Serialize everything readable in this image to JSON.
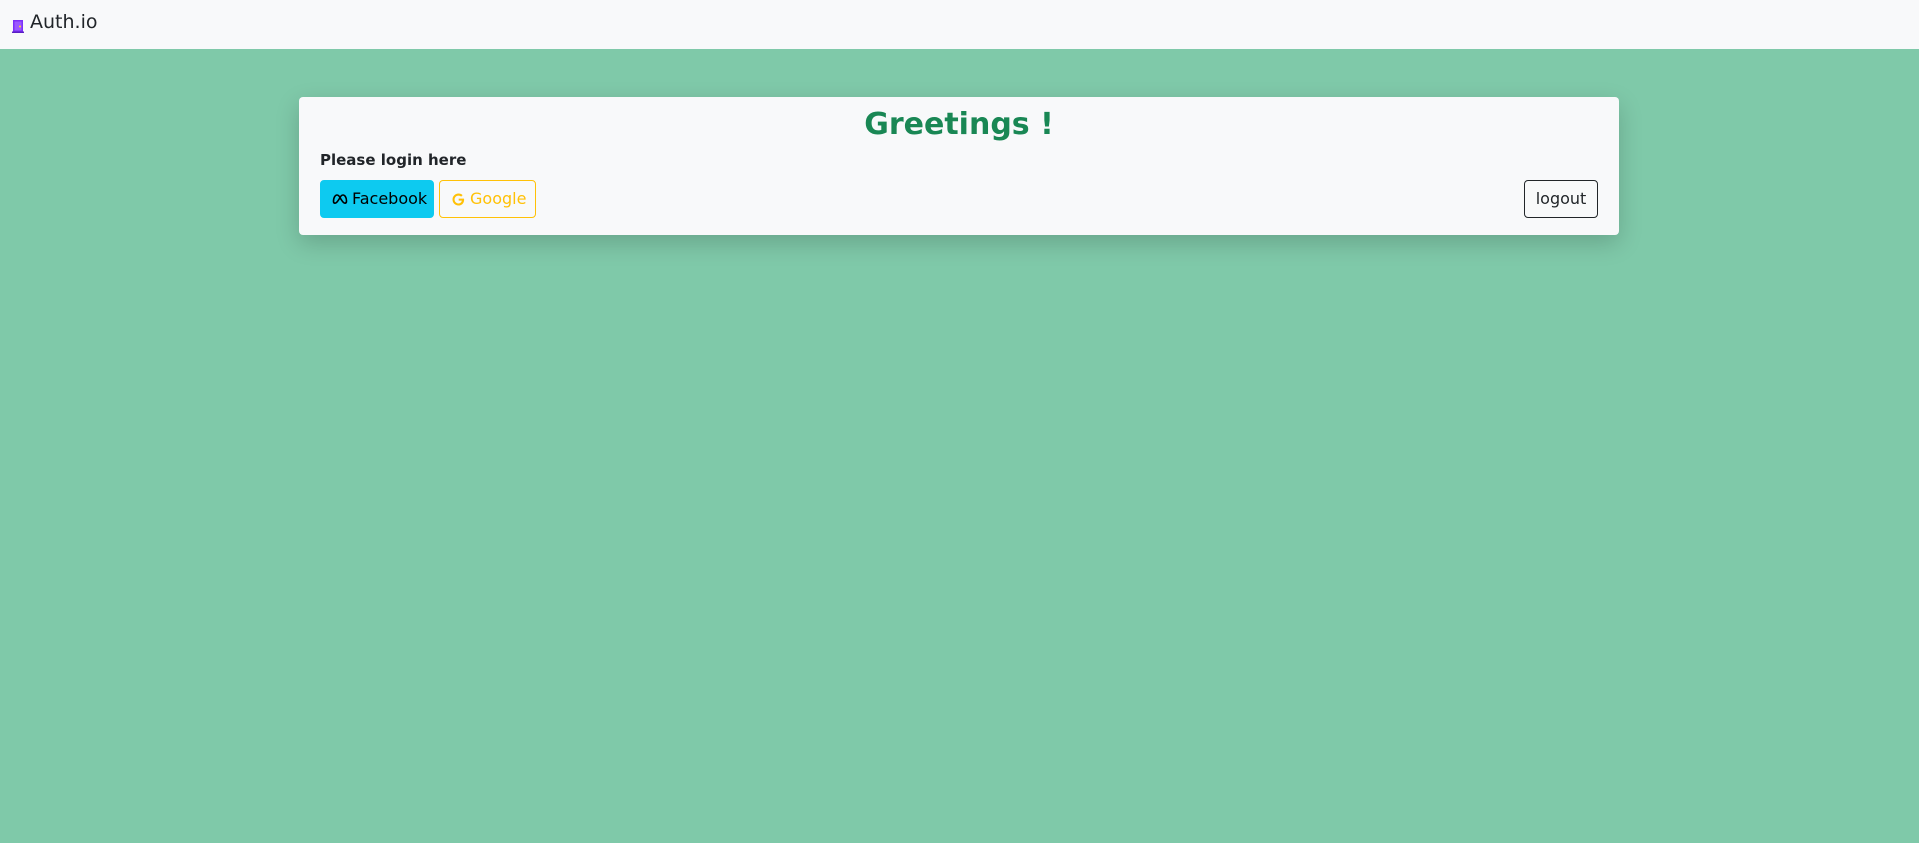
{
  "navbar": {
    "brand_label": "Auth.io",
    "brand_icon": "door-icon"
  },
  "card": {
    "greeting": "Greetings !",
    "subtitle": "Please login here",
    "buttons": {
      "facebook_label": "Facebook",
      "facebook_icon": "meta-icon",
      "google_label": "Google",
      "google_icon": "google-icon",
      "logout_label": "logout"
    }
  },
  "colors": {
    "page_background": "#7fc9a9",
    "greeting": "#198754",
    "facebook_button": "#0dcaf0",
    "google_outline": "#ffc107"
  }
}
